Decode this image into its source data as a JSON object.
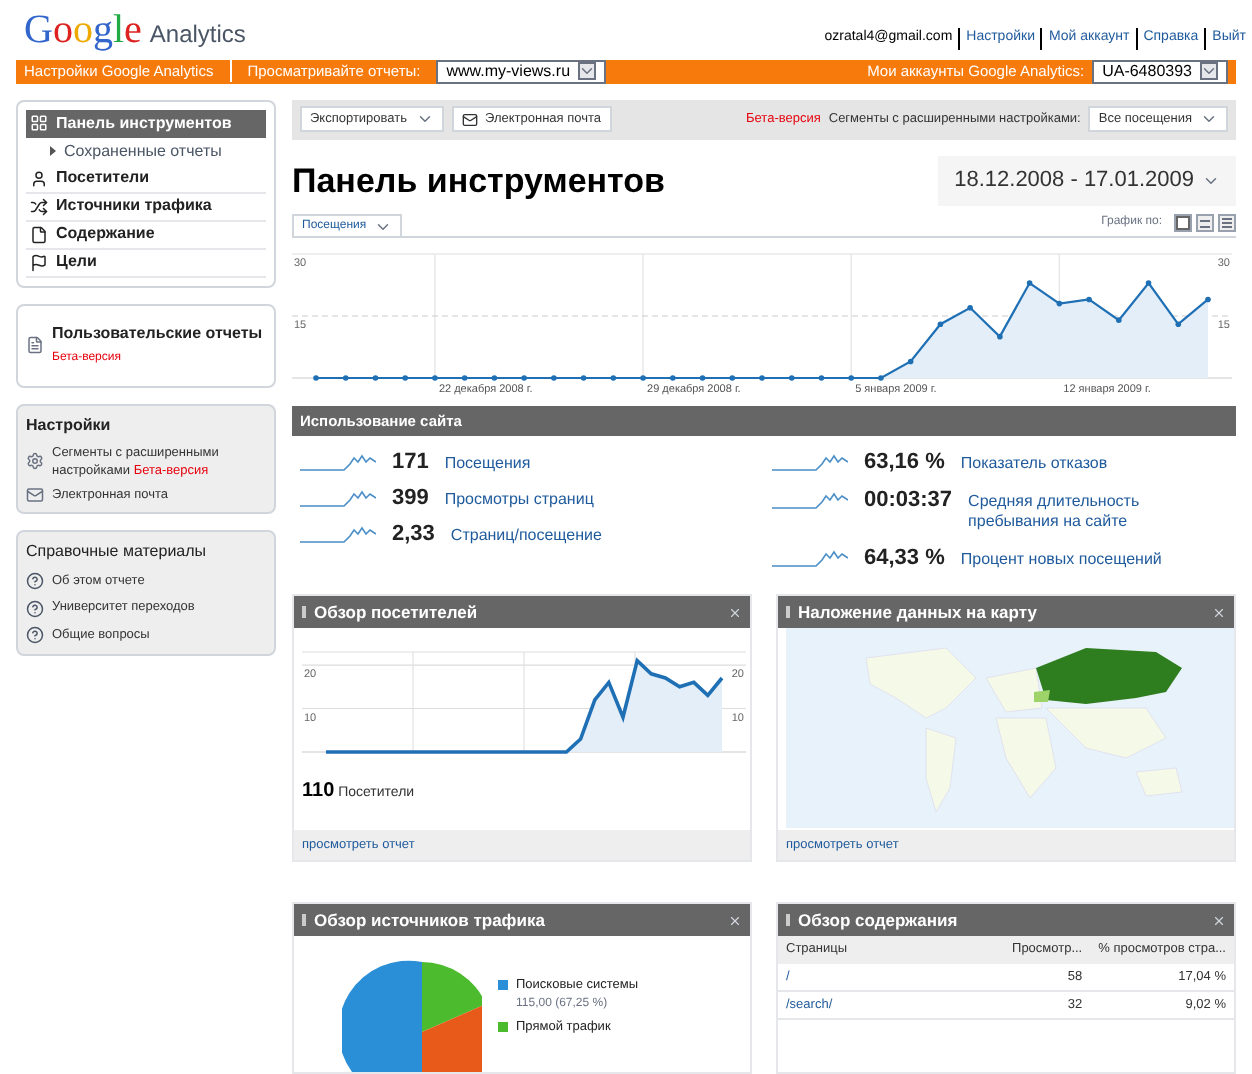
{
  "header": {
    "logo": {
      "brand": "Google",
      "product": "Analytics"
    },
    "user_links": [
      "ozratal4@gmail.com",
      "Настройки",
      "Мой аккаунт",
      "Справка",
      "Выйт"
    ]
  },
  "orange_bar": {
    "settings_link": "Настройки Google Analytics",
    "report_label": "Просматривайте отчеты:",
    "report_select": "www.my-views.ru",
    "accounts_label": "Мои аккаунты Google Analytics:",
    "accounts_select": "UA-6480393"
  },
  "sidebar": {
    "nav": [
      {
        "label": "Панель инструментов",
        "kind": "dashboard",
        "selected": true
      },
      {
        "label": "Сохраненные отчеты",
        "kind": "sub",
        "selected": false
      },
      {
        "label": "Посетители",
        "kind": "visitors",
        "selected": false
      },
      {
        "label": "Источники трафика",
        "kind": "traffic",
        "selected": false
      },
      {
        "label": "Содержание",
        "kind": "content",
        "selected": false
      },
      {
        "label": "Цели",
        "kind": "goals",
        "selected": false
      }
    ],
    "custom_reports": {
      "label": "Пользовательские отчеты",
      "badge": "Бета-версия"
    },
    "settings": {
      "title": "Настройки",
      "items": [
        {
          "label": "Сегменты с расширенными настройками",
          "badge": "Бета-версия",
          "kind": "segments"
        },
        {
          "label": "Электронная почта",
          "kind": "email"
        }
      ]
    },
    "help": {
      "title": "Справочные материалы",
      "items": [
        "Об этом отчете",
        "Университет переходов",
        "Общие вопросы"
      ]
    }
  },
  "toolbar": {
    "export": "Экспортировать",
    "email": "Электронная почта",
    "beta": "Бета-версия",
    "segments_label": "Сегменты с расширенными настройками:",
    "segments_select": "Все посещения"
  },
  "title": "Панель инструментов",
  "date_range": "18.12.2008 - 17.01.2009",
  "graph_by": {
    "label": "График по:",
    "views": [
      {
        "kind": "day",
        "selected": true
      },
      {
        "kind": "week",
        "selected": false
      },
      {
        "kind": "month",
        "selected": false
      }
    ]
  },
  "main_chart": {
    "right_axis_labels": [
      "30",
      "15"
    ],
    "x_axis_labels": [
      "22 декабря 2008 г.",
      "29 декабря 2008 г.",
      "5 января 2009 г.",
      "12 января 2009 г."
    ],
    "chart_data": {
      "type": "area",
      "grid": true,
      "ref_lines": [
        {
          "axis": "y",
          "value": 15
        }
      ],
      "ylim": [
        0,
        30
      ],
      "yticks": [
        15,
        30
      ],
      "series": [
        {
          "name": "Посещения",
          "color": "#1f6fb5",
          "values": [
            0,
            0,
            0,
            0,
            0,
            0,
            0,
            0,
            0,
            0,
            0,
            0,
            0,
            0,
            0,
            0,
            0,
            0,
            0,
            0,
            4,
            13,
            17,
            10,
            23,
            18,
            19,
            14,
            23,
            13,
            19
          ]
        }
      ]
    }
  },
  "site_usage": {
    "title": "Использование сайта",
    "left": [
      {
        "value": "171",
        "label": "Посещения"
      },
      {
        "value": "399",
        "label": "Просмотры страниц"
      },
      {
        "value": "2,33",
        "label": "Страниц/посещение"
      }
    ],
    "right": [
      {
        "value": "63,16 %",
        "label": "Показатель отказов"
      },
      {
        "value": "00:03:37",
        "label": "Средняя длительность пребывания на сайте"
      },
      {
        "value": "64,33 %",
        "label": "Процент новых посещений"
      }
    ]
  },
  "visitors_widget": {
    "title": "Обзор посетителей",
    "right_axis_labels": [
      "20",
      "10"
    ],
    "chart_data": {
      "type": "area",
      "grid": true,
      "ylim": [
        0,
        23
      ],
      "yticks": [
        10,
        20
      ],
      "values": [
        0,
        0,
        0,
        0,
        0,
        0,
        0,
        0,
        0,
        0,
        0,
        0,
        0,
        0,
        0,
        0,
        0,
        0,
        3,
        12,
        16,
        8,
        21,
        18,
        17,
        15,
        16,
        13,
        17
      ]
    },
    "count": "110",
    "count_label": "Посетители",
    "footer_link": "просмотреть отчет"
  },
  "map_widget": {
    "title": "Наложение данных на карту",
    "footer_link": "просмотреть отчет"
  },
  "traffic_widget": {
    "title": "Обзор источников трафика",
    "legend": [
      {
        "label": "Поисковые системы",
        "detail": "115,00 (67,25 %)",
        "color": "#2a8fd6"
      },
      {
        "label": "Прямой трафик",
        "color": "#4cbb2e"
      }
    ]
  },
  "content_widget": {
    "title": "Обзор содержания",
    "columns": [
      "Страницы",
      "Просмотр...",
      "% просмотров стра..."
    ],
    "rows": [
      [
        "/",
        "58",
        "17,04 %"
      ],
      [
        "/search/",
        "32",
        "9,02 %"
      ]
    ]
  }
}
